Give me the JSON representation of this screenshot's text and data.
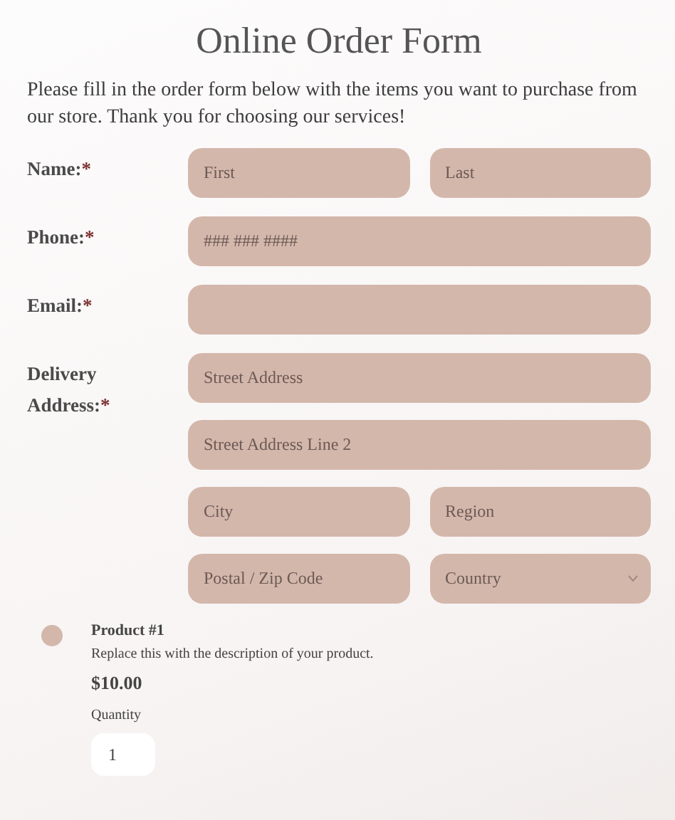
{
  "title": "Online Order Form",
  "intro": "Please fill in the order form below with the items you want to purchase from our store. Thank you for choosing our services!",
  "fields": [
    {
      "label": "Name:",
      "required_mark": "*",
      "rows": [
        [
          {
            "kind": "text",
            "placeholder": "First"
          },
          {
            "kind": "text",
            "placeholder": "Last"
          }
        ]
      ]
    },
    {
      "label": "Phone:",
      "required_mark": "*",
      "rows": [
        [
          {
            "kind": "text",
            "placeholder": "### ### ####"
          }
        ]
      ]
    },
    {
      "label": "Email:",
      "required_mark": "*",
      "rows": [
        [
          {
            "kind": "text"
          }
        ]
      ]
    },
    {
      "label": "Delivery Address:",
      "required_mark": "*",
      "rows": [
        [
          {
            "kind": "text",
            "placeholder": "Street Address"
          }
        ],
        [
          {
            "kind": "text",
            "placeholder": "Street Address Line 2"
          }
        ],
        [
          {
            "kind": "text",
            "placeholder": "City"
          },
          {
            "kind": "text",
            "placeholder": "Region"
          }
        ],
        [
          {
            "kind": "text",
            "placeholder": "Postal / Zip Code"
          },
          {
            "kind": "select",
            "placeholder": "Country"
          }
        ]
      ]
    }
  ],
  "product": {
    "name": "Product #1",
    "selected": false,
    "description": "Replace this with the description of your product.",
    "price": "$10.00",
    "quantity_label": "Quantity",
    "quantity": "1"
  }
}
